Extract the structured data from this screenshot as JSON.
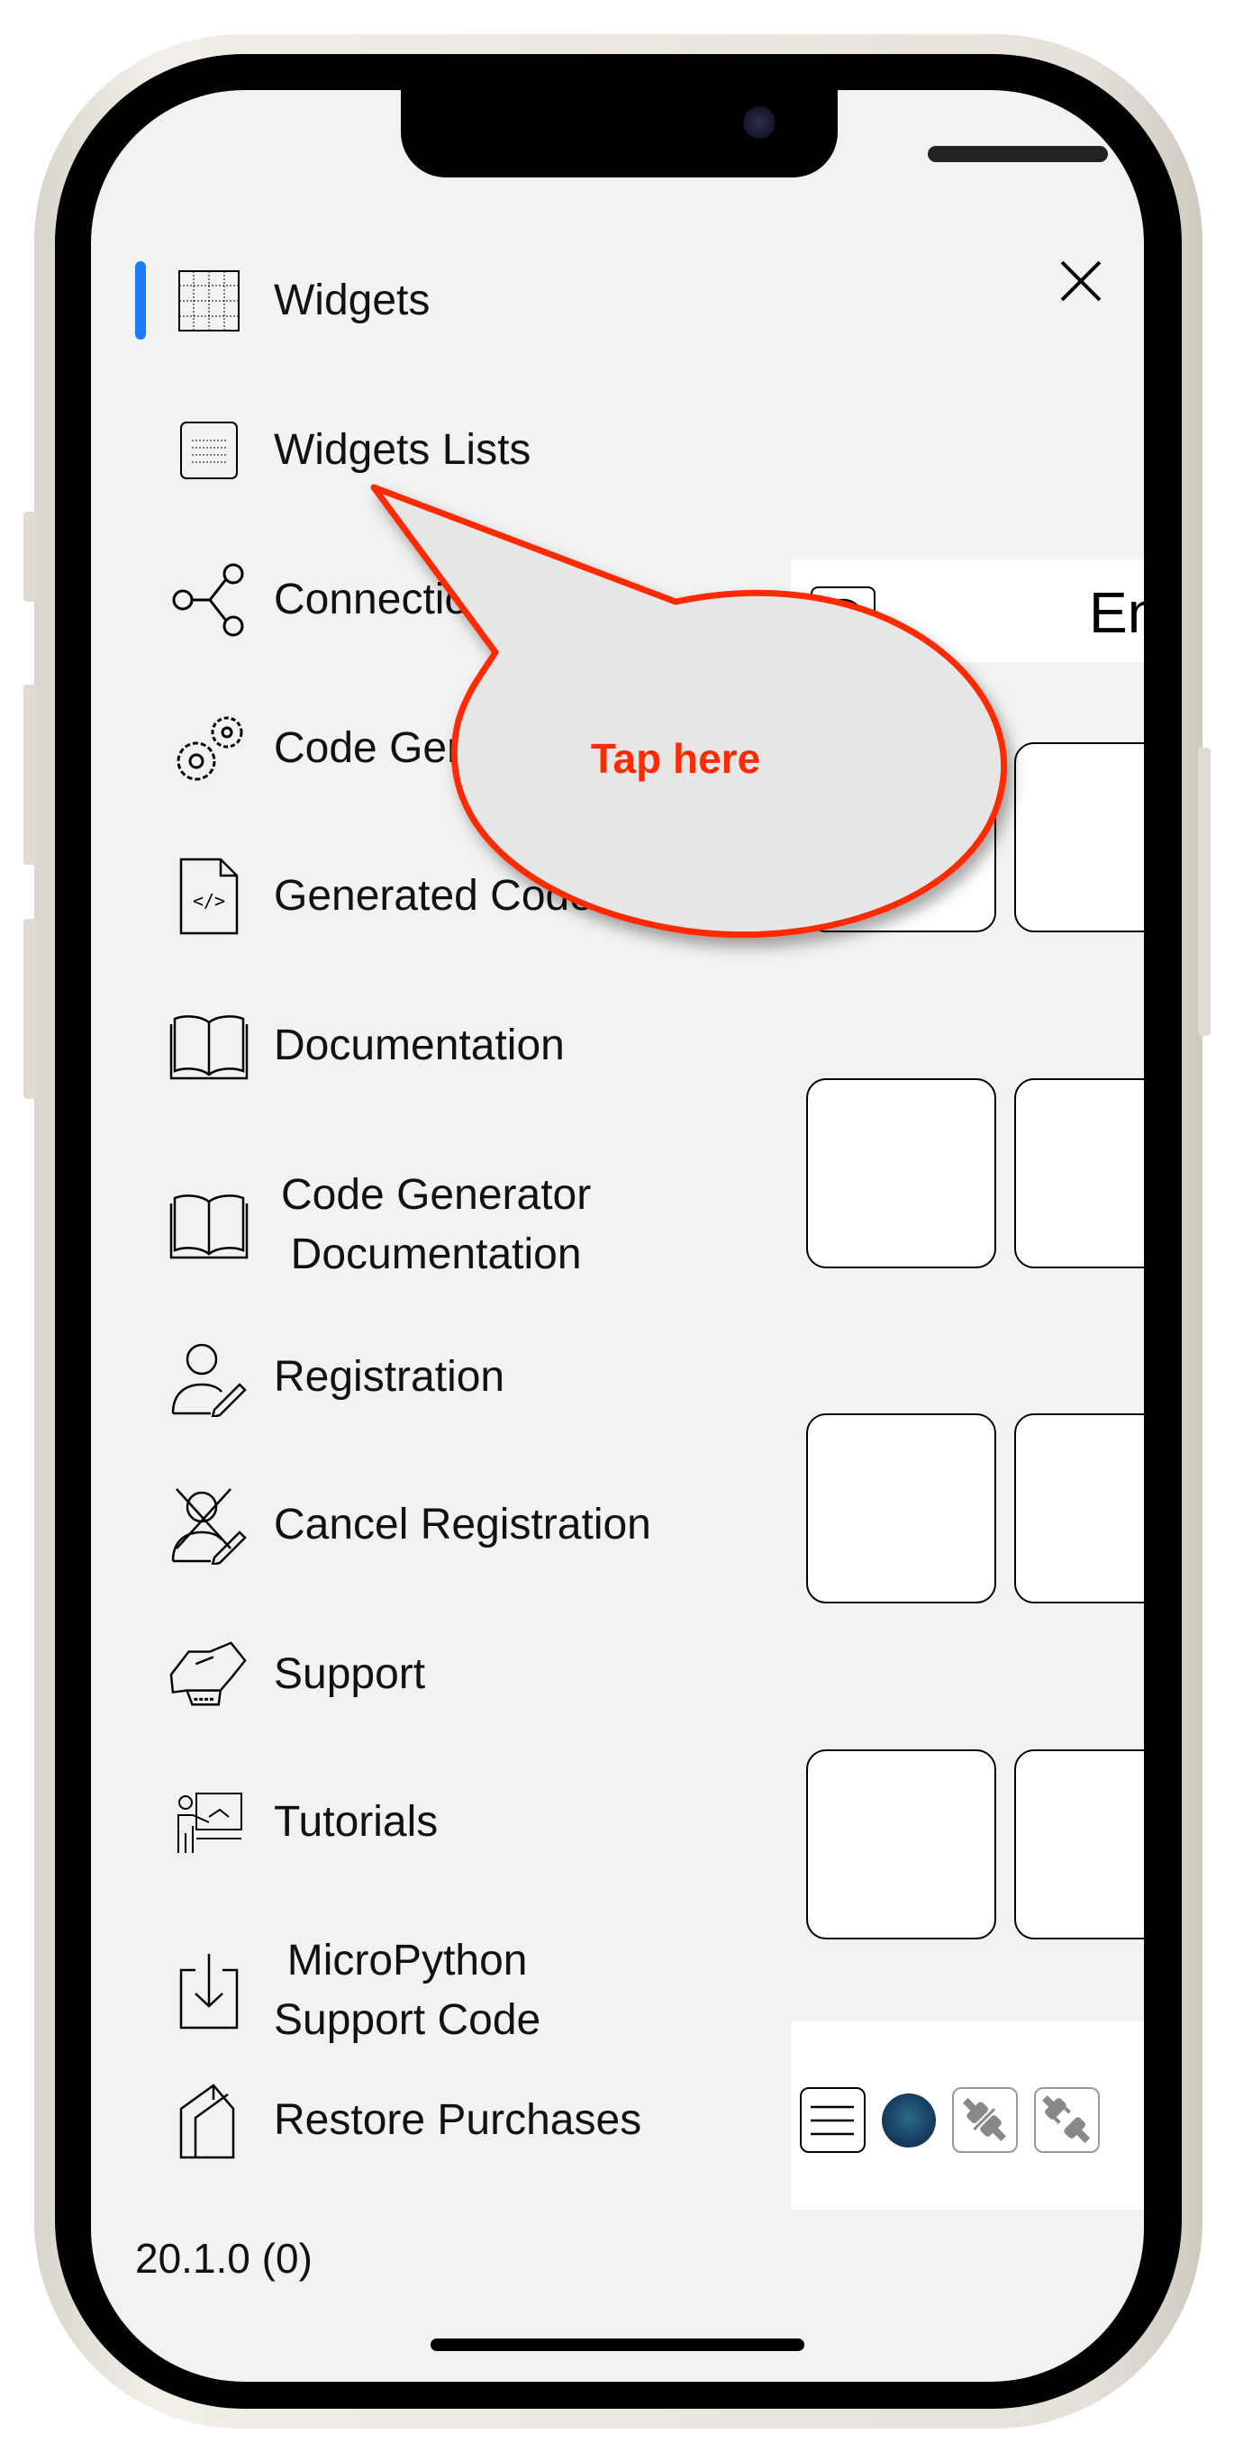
{
  "menu": {
    "items": [
      {
        "label": "Widgets",
        "icon": "grid-icon",
        "selected": true
      },
      {
        "label": "Widgets Lists",
        "icon": "list-icon"
      },
      {
        "label": "Connection",
        "icon": "share-nodes-icon"
      },
      {
        "label": "Code Generator",
        "icon": "gears-icon"
      },
      {
        "label": "Generated Code",
        "icon": "code-file-icon"
      },
      {
        "label": "Documentation",
        "icon": "book-icon"
      },
      {
        "label": "Code Generator\nDocumentation",
        "icon": "book-icon"
      },
      {
        "label": "Registration",
        "icon": "user-pen-icon"
      },
      {
        "label": "Cancel Registration",
        "icon": "user-cancel-icon"
      },
      {
        "label": "Support",
        "icon": "handshake-icon"
      },
      {
        "label": "Tutorials",
        "icon": "presenter-icon"
      },
      {
        "label": "MicroPython\nSupport Code",
        "icon": "download-icon"
      },
      {
        "label": "Restore Purchases",
        "icon": "restore-icon"
      }
    ],
    "version": "20.1.0 (0)",
    "accent": "#1a7cf5"
  },
  "background_screen": {
    "title": "En",
    "bottom_icons": [
      "menu-icon",
      "status-led-icon",
      "connect-plug-icon",
      "disconnect-plug-icon"
    ]
  },
  "callout": {
    "text": "Tap here",
    "color": "#ff2a00"
  }
}
